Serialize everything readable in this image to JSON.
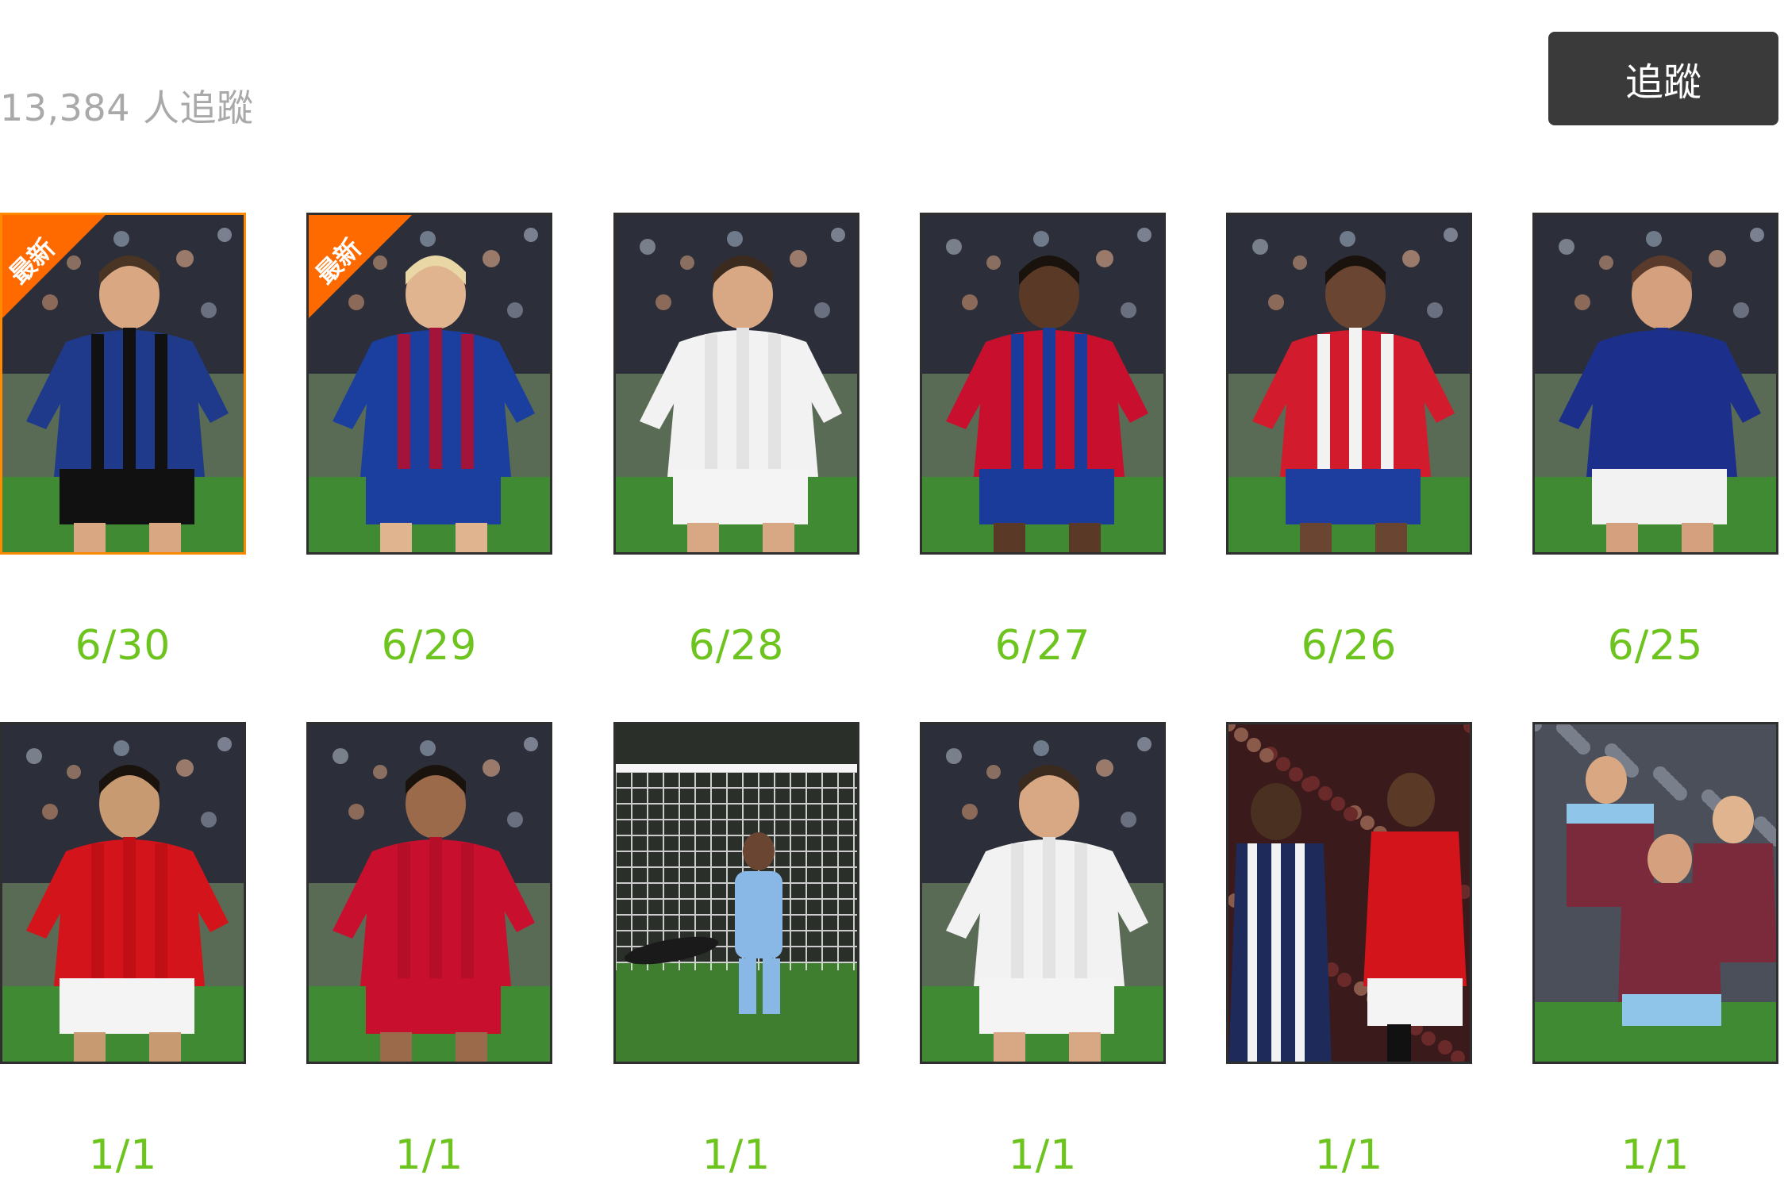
{
  "header": {
    "follower_count": "13,384",
    "follower_suffix": "人追蹤",
    "follow_button_label": "追蹤"
  },
  "badge_label": "最新",
  "colors": {
    "date_text": "#6dc41e",
    "ribbon": "#ff6a00",
    "highlight_border": "#ff8a00",
    "button_bg": "#3a3a3a",
    "muted_text": "#a9a9a9"
  },
  "rows": [
    {
      "items": [
        {
          "date": "6/30",
          "badge": true,
          "selected": true,
          "kit": "inter-blue-black-stripes"
        },
        {
          "date": "6/29",
          "badge": true,
          "selected": false,
          "kit": "barcelona-blaugrana"
        },
        {
          "date": "6/28",
          "badge": false,
          "selected": false,
          "kit": "real-madrid-white"
        },
        {
          "date": "6/27",
          "badge": false,
          "selected": false,
          "kit": "crystal-palace-red-blue"
        },
        {
          "date": "6/26",
          "badge": false,
          "selected": false,
          "kit": "atletico-red-white"
        },
        {
          "date": "6/25",
          "badge": false,
          "selected": false,
          "kit": "chelsea-blue"
        }
      ]
    },
    {
      "items": [
        {
          "date": "1/1",
          "badge": false,
          "selected": false,
          "kit": "man-utd-red"
        },
        {
          "date": "1/1",
          "badge": false,
          "selected": false,
          "kit": "liverpool-red"
        },
        {
          "date": "1/1",
          "badge": false,
          "selected": false,
          "kit": "goal-net-keeper"
        },
        {
          "date": "1/1",
          "badge": false,
          "selected": false,
          "kit": "real-madrid-white"
        },
        {
          "date": "1/1",
          "badge": false,
          "selected": false,
          "kit": "man-utd-vs-wba"
        },
        {
          "date": "1/1",
          "badge": false,
          "selected": false,
          "kit": "burnley-claret"
        }
      ]
    }
  ]
}
